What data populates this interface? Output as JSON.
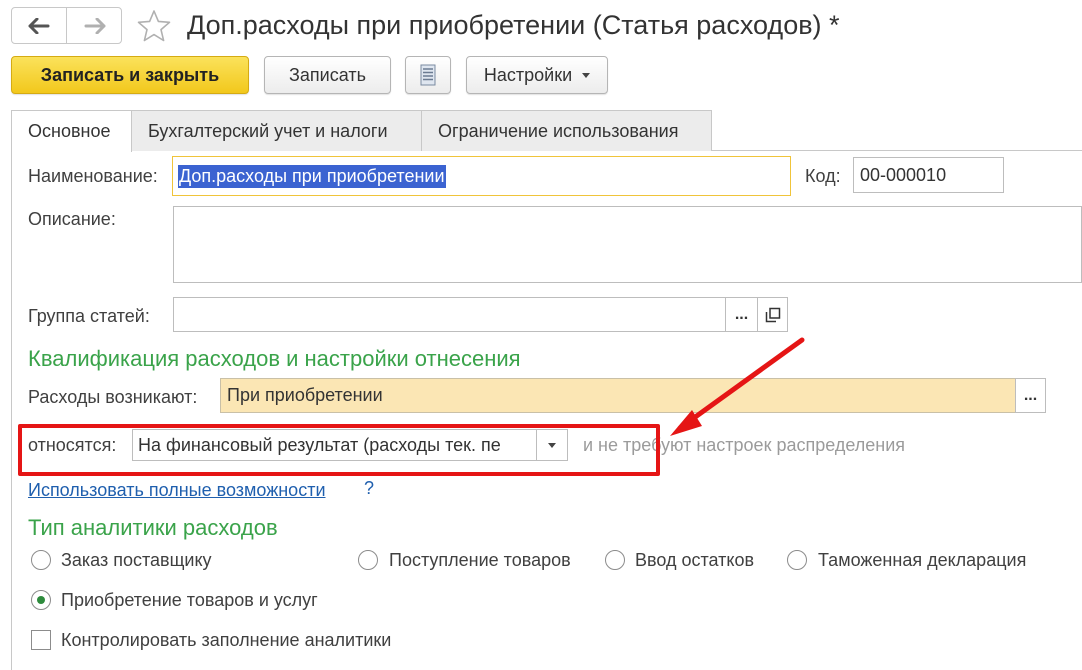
{
  "window": {
    "title": "Доп.расходы при приобретении (Статья расходов) *",
    "back_icon": "arrow-left-icon",
    "forward_icon": "arrow-right-icon",
    "favorite_icon": "star-icon"
  },
  "toolbar": {
    "save_close_label": "Записать и закрыть",
    "save_label": "Записать",
    "list_icon": "document-list-icon",
    "settings_label": "Настройки"
  },
  "tabs": [
    {
      "label": "Основное",
      "active": true
    },
    {
      "label": "Бухгалтерский учет и налоги",
      "active": false
    },
    {
      "label": "Ограничение использования",
      "active": false
    }
  ],
  "form": {
    "name_label": "Наименование:",
    "name_value": "Доп.расходы при приобретении",
    "code_label": "Код:",
    "code_value": "00-000010",
    "description_label": "Описание:",
    "description_value": "",
    "group_label": "Группа статей:",
    "group_value": "",
    "group_select_label": "...",
    "group_open_icon": "open-window-icon"
  },
  "qualification": {
    "title": "Квалификация расходов и настройки отнесения",
    "arise_label": "Расходы возникают:",
    "arise_value": "При приобретении",
    "arise_select_label": "...",
    "relate_label": "относятся:",
    "relate_value": "На финансовый результат (расходы тек. пе",
    "relate_hint": "и не требуют настроек распределения",
    "full_link": "Использовать полные возможности",
    "help_label": "?"
  },
  "analytics": {
    "title": "Тип аналитики расходов",
    "options": [
      {
        "label": "Заказ поставщику",
        "selected": false
      },
      {
        "label": "Поступление товаров",
        "selected": false
      },
      {
        "label": "Ввод остатков",
        "selected": false
      },
      {
        "label": "Таможенная декларация",
        "selected": false
      },
      {
        "label": "Приобретение товаров и услуг",
        "selected": true
      }
    ],
    "control_label": "Контролировать заполнение аналитики",
    "control_checked": false
  },
  "colors": {
    "primary_button": "#f5d133",
    "section_title": "#3aa34a",
    "highlight_box": "#e51515",
    "link": "#1f5fae",
    "required_field_bg": "#fbe6b4"
  }
}
